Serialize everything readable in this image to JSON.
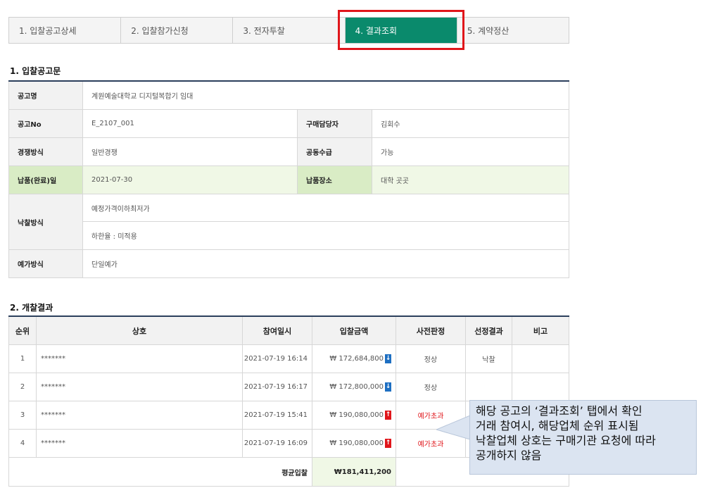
{
  "tabs": [
    "1. 입찰공고상세",
    "2. 입찰참가신청",
    "3. 전자투찰",
    "4. 결과조회",
    "5. 계약정산"
  ],
  "section1": {
    "title": "1. 입찰공고문",
    "announcement_name_label": "공고명",
    "announcement_name": "계원예술대학교 디지털복합기 임대",
    "announcement_no_label": "공고No",
    "announcement_no": "E_2107_001",
    "buyer_label": "구매담당자",
    "buyer": "김회수",
    "competition_label": "경쟁방식",
    "competition": "일반경쟁",
    "joint_label": "공동수급",
    "joint": "가능",
    "delivery_date_label": "납품(완료)일",
    "delivery_date": "2021-07-30",
    "delivery_place_label": "납품장소",
    "delivery_place": "대학 곳곳",
    "award_method_label": "낙찰방식",
    "award_method_1": "예정가격이하최저가",
    "award_method_2": "하한율 : 미적용",
    "estimate_method_label": "예가방식",
    "estimate_method": "단일예가"
  },
  "section2": {
    "title": "2. 개찰결과",
    "headers": [
      "순위",
      "상호",
      "참여일시",
      "입찰금액",
      "사전판정",
      "선정결과",
      "비고"
    ],
    "rows": [
      {
        "rank": "1",
        "name": "*******",
        "datetime": "2021-07-19 16:14",
        "amount": "₩ 172,684,800",
        "dir": "↓",
        "judge": "정상",
        "result": "낙찰",
        "note": ""
      },
      {
        "rank": "2",
        "name": "*******",
        "datetime": "2021-07-19 16:17",
        "amount": "₩ 172,800,000",
        "dir": "↓",
        "judge": "정상",
        "result": "",
        "note": ""
      },
      {
        "rank": "3",
        "name": "*******",
        "datetime": "2021-07-19 15:41",
        "amount": "₩ 190,080,000",
        "dir": "↑",
        "judge": "예가초과",
        "result": "",
        "note": ""
      },
      {
        "rank": "4",
        "name": "*******",
        "datetime": "2021-07-19 16:09",
        "amount": "₩ 190,080,000",
        "dir": "↑",
        "judge": "예가초과",
        "result": "",
        "note": ""
      }
    ],
    "avg_label": "평균입찰",
    "avg_value": "₩181,411,200"
  },
  "callout": {
    "line1": "해당 공고의 ‘결과조회’ 탭에서 확인",
    "line2": "거래 참여시, 해당업체 순위 표시됨",
    "line3": "낙찰업체 상호는 구매기관 요청에 따라",
    "line4": "공개하지 않음"
  },
  "colors": {
    "active_tab": "#0a8a6c",
    "highlight": "#e0161b",
    "table_border": "#2b3f5c",
    "callout_bg": "#dbe4f1"
  }
}
